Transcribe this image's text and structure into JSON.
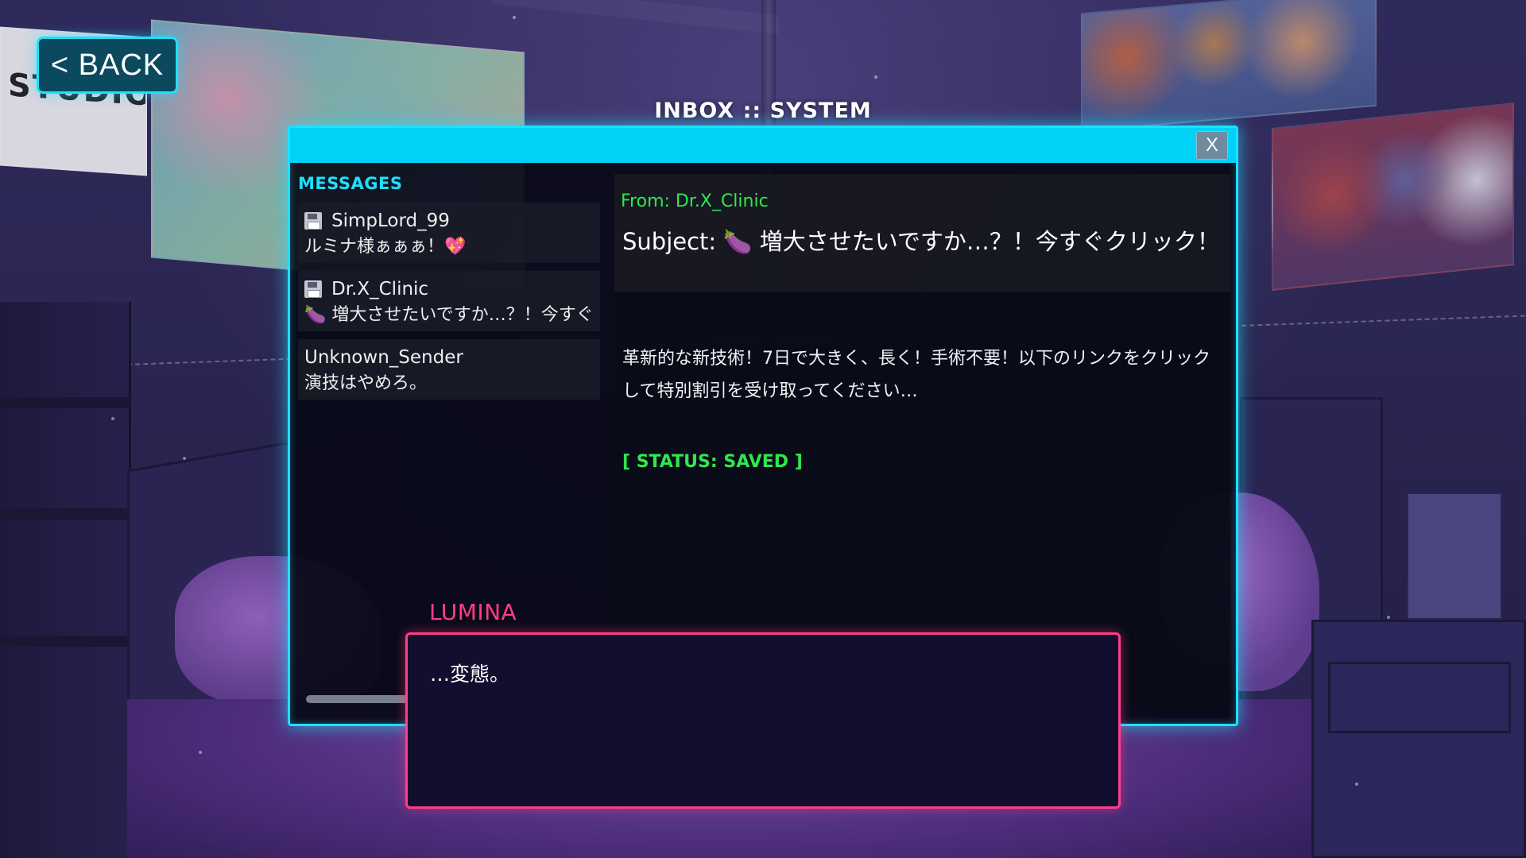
{
  "back_button": {
    "label": "< BACK"
  },
  "window": {
    "title": "INBOX :: SYSTEM",
    "close_label": "X"
  },
  "messages": {
    "header": "MESSAGES",
    "items": [
      {
        "sender": "SimpLord_99",
        "preview": "ルミナ様ぁぁぁ！💖",
        "icon": "save-icon"
      },
      {
        "sender": "Dr.X_Clinic",
        "preview": "🍆 増大させたいですか…？！今すぐク",
        "icon": "save-icon"
      },
      {
        "sender": "Unknown_Sender",
        "preview": "演技はやめろ。",
        "icon": ""
      }
    ]
  },
  "detail": {
    "from": "From: Dr.X_Clinic",
    "subject": "Subject: 🍆 増大させたいですか…？！今すぐクリック！",
    "body": "革新的な新技術！7日で大きく、長く！手術不要！以下のリンクをクリックして特別割引を受け取ってください…",
    "status": "[ STATUS: SAVED ]"
  },
  "dialogue": {
    "speaker": "LUMINA",
    "text": "…変態。"
  },
  "colors": {
    "accent_cyan": "#1ee0ff",
    "status_green": "#2ee84e",
    "speaker_pink": "#ff3d8a"
  }
}
